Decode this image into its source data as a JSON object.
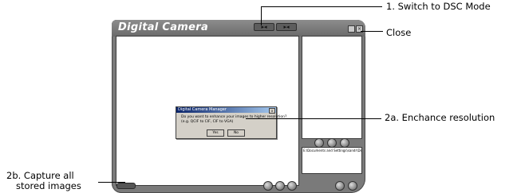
{
  "app": {
    "title": "Digital Camera",
    "path_text": "E:\\Documents and Settings\\sandr\\De"
  },
  "dialog": {
    "title": "Digital Camera Manager",
    "message_line1": "Do you want to enhance your images to higher resolution?",
    "message_line2": "(e.g. QCIF to CIF, CIF to VGA)",
    "yes_label": "Yes",
    "no_label": "No",
    "close_glyph": "x"
  },
  "callouts": {
    "switch_dsc": "1. Switch to DSC Mode",
    "close": "Close",
    "enhance": "2a. Enchance resolution",
    "capture_line1": "2b. Capture all",
    "capture_line2": "stored images"
  }
}
